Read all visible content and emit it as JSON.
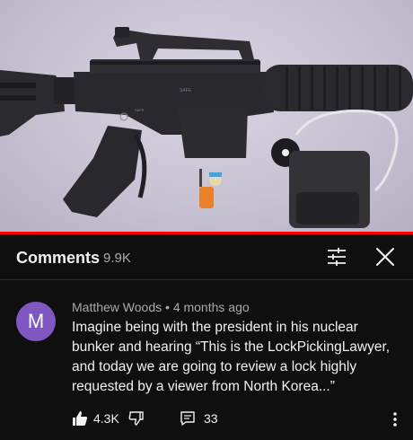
{
  "colors": {
    "background": "#0f0f0f",
    "progress": "#ff0000",
    "avatar": "#7e57c2",
    "secondary_text": "#aaaaaa"
  },
  "video": {
    "progress_fraction": 1.0,
    "receiver_text": "SAFE",
    "safety_label": "SAFE"
  },
  "header": {
    "title": "Comments",
    "count": "9.9K",
    "filter_icon": "filter-sliders-icon",
    "close_icon": "close-icon"
  },
  "comment": {
    "avatar_letter": "M",
    "author": "Matthew Woods",
    "separator": "•",
    "time": "4 months ago",
    "text": "Imagine being with the president in his nuclear bunker and hearing “This is the LockPickingLawyer, and today we are going to review a lock highly requested by a viewer from North Korea...”",
    "likes": "4.3K",
    "replies": "33",
    "like_icon": "thumbs-up-icon",
    "dislike_icon": "thumbs-down-icon",
    "reply_icon": "reply-icon",
    "more_icon": "more-vertical-icon"
  }
}
